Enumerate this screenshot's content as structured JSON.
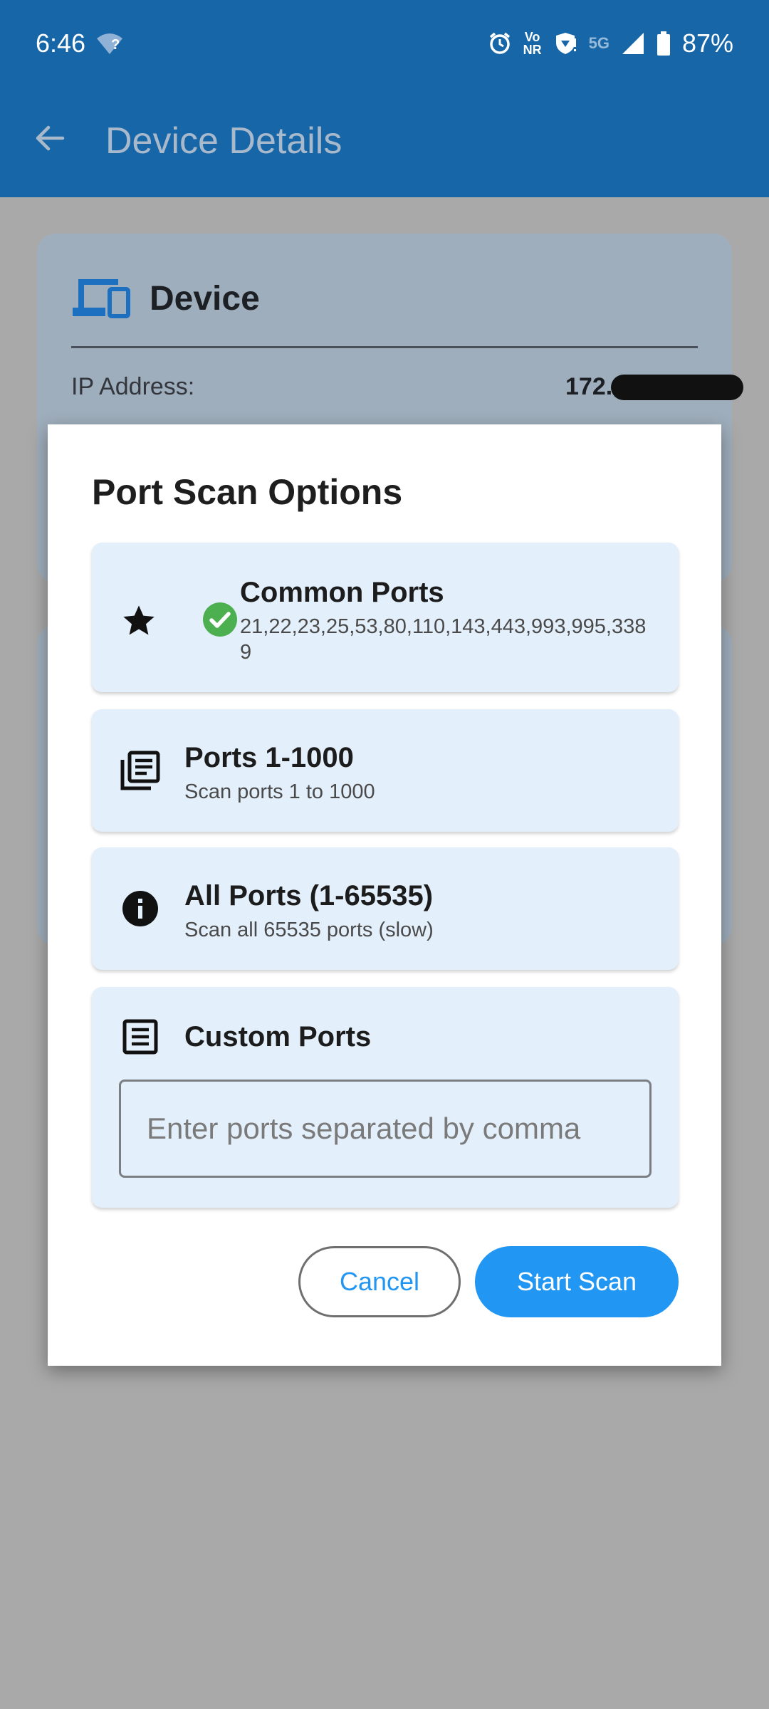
{
  "status_bar": {
    "time": "6:46",
    "wifi_badge": "?",
    "volte_top": "Vo",
    "volte_bottom": "NR",
    "network": "5G",
    "battery": "87%",
    "icons": [
      "wifi-icon",
      "alarm-icon",
      "volte-icon",
      "shield-icon",
      "signal-icon",
      "battery-icon"
    ]
  },
  "app_bar": {
    "title": "Device Details"
  },
  "background": {
    "card_title": "Device",
    "ip_label": "IP Address:",
    "ip_value": "172."
  },
  "dialog": {
    "title": "Port Scan Options",
    "options": [
      {
        "title": "Common Ports",
        "subtitle": "21,22,23,25,53,80,110,143,443,993,995,3389",
        "icon": "star-icon",
        "selected": true
      },
      {
        "title": "Ports 1-1000",
        "subtitle": "Scan ports 1 to 1000",
        "icon": "library-icon",
        "selected": false
      },
      {
        "title": "All Ports (1-65535)",
        "subtitle": "Scan all 65535 ports (slow)",
        "icon": "info-icon",
        "selected": false
      },
      {
        "title": "Custom Ports",
        "icon": "list-icon",
        "input_value": "",
        "input_placeholder": "Enter ports separated by comma"
      }
    ],
    "cancel_label": "Cancel",
    "start_label": "Start Scan"
  },
  "colors": {
    "primary": "#1766a8",
    "accent": "#2196f3",
    "option_bg": "#e3effb",
    "check_green": "#4caf50"
  }
}
